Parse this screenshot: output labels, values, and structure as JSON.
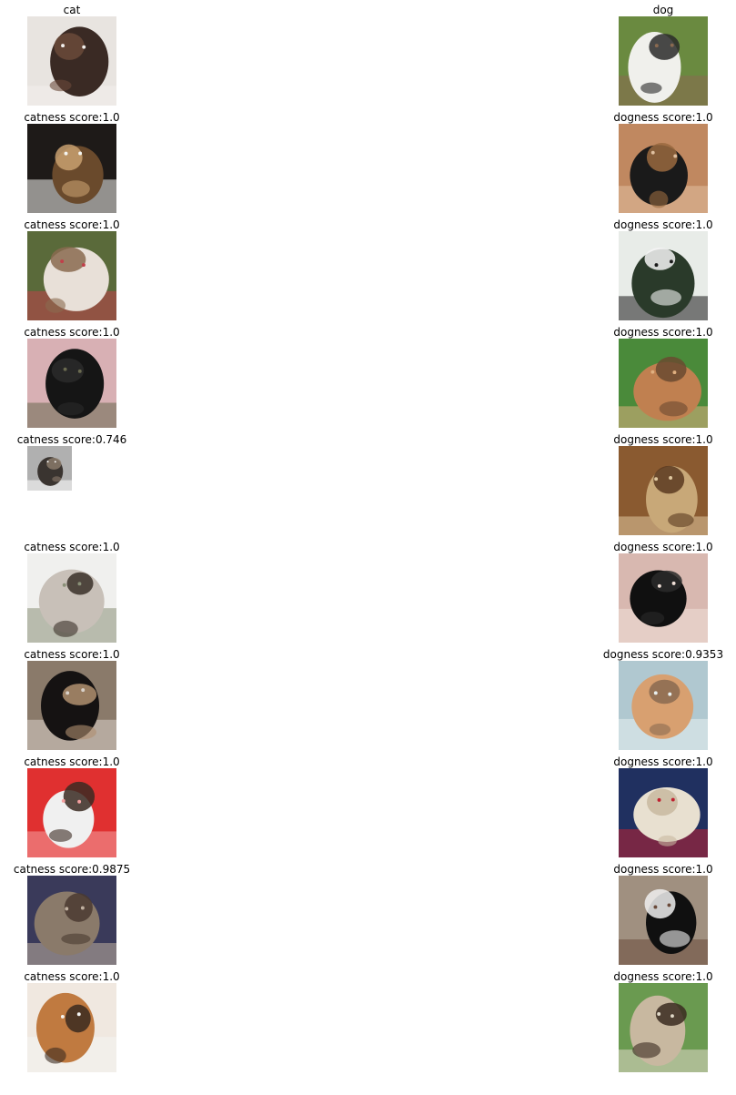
{
  "cat_column": {
    "header": "cat",
    "items": [
      {
        "label": "",
        "alt": "tortoiseshell cat lying on white surface",
        "score": null
      },
      {
        "label": "catness score:1.0",
        "alt": "tortoiseshell cat with open mouth",
        "score": 1.0
      },
      {
        "label": "catness score:1.0",
        "alt": "siamese cat lying down",
        "score": 1.0
      },
      {
        "label": "catness score:1.0",
        "alt": "black cat with yellow eyes",
        "score": 1.0
      },
      {
        "label": "catness score:0.746",
        "alt": "small tabby cat image",
        "score": 0.746
      },
      {
        "label": "catness score:1.0",
        "alt": "tabby kitten standing",
        "score": 1.0
      },
      {
        "label": "catness score:1.0",
        "alt": "black cat held by a person",
        "score": 1.0
      },
      {
        "label": "catness score:1.0",
        "alt": "calico kitten on red background",
        "score": 1.0
      },
      {
        "label": "catness score:0.9875",
        "alt": "cat in front of shelves",
        "score": 0.9875
      },
      {
        "label": "catness score:1.0",
        "alt": "calico cat close-up",
        "score": 1.0
      }
    ]
  },
  "dog_column": {
    "header": "dog",
    "items": [
      {
        "label": "",
        "alt": "jack russell terrier with red leash on grass",
        "score": null
      },
      {
        "label": "dogness score:1.0",
        "alt": "black and tan hound dog",
        "score": 1.0
      },
      {
        "label": "dogness score:1.0",
        "alt": "dalmatian in front of window",
        "score": 1.0
      },
      {
        "label": "dogness score:1.0",
        "alt": "tan dog with large ears on grass",
        "score": 1.0
      },
      {
        "label": "dogness score:1.0",
        "alt": "brown shaggy dog",
        "score": 1.0
      },
      {
        "label": "dogness score:1.0",
        "alt": "black puppy",
        "score": 1.0
      },
      {
        "label": "dogness score:0.9353",
        "alt": "dog behind glass door",
        "score": 0.9353
      },
      {
        "label": "dogness score:1.0",
        "alt": "white fluffy dog",
        "score": 1.0
      },
      {
        "label": "dogness score:1.0",
        "alt": "black and white small dog",
        "score": 1.0
      },
      {
        "label": "dogness score:1.0",
        "alt": "german shepherd sitting on grass",
        "score": 1.0
      }
    ]
  }
}
